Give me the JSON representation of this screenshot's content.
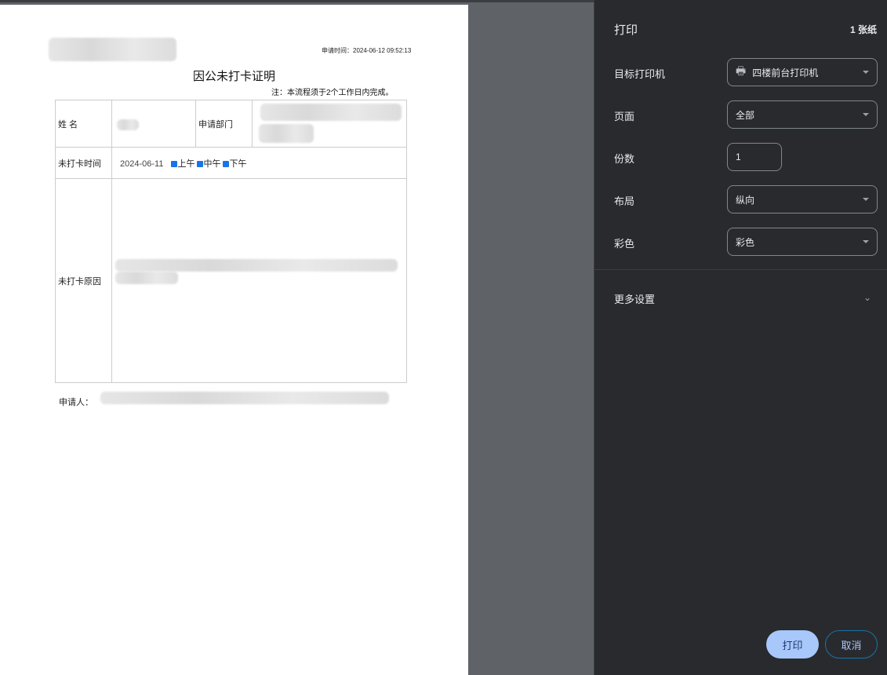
{
  "document": {
    "request_time": "申请时间：2024-06-12 09:52:13",
    "title": "因公未打卡证明",
    "note": "注：本流程须于2个工作日内完成。",
    "name_label": "姓 名",
    "dept_label": "申请部门",
    "time_label": "未打卡时间",
    "date": "2024-06-11",
    "periods": [
      "上午",
      "中午",
      "下午"
    ],
    "reason_label": "未打卡原因",
    "applicant_label": "申请人："
  },
  "panel": {
    "title": "打印",
    "sheets": "1 张纸",
    "printer_label": "目标打印机",
    "printer": "四楼前台打印机",
    "pages_label": "页面",
    "pages": "全部",
    "copies_label": "份数",
    "copies": "1",
    "layout_label": "布局",
    "layout": "纵向",
    "color_label": "彩色",
    "color": "彩色",
    "more": "更多设置",
    "print_btn": "打印",
    "cancel_btn": "取消"
  }
}
